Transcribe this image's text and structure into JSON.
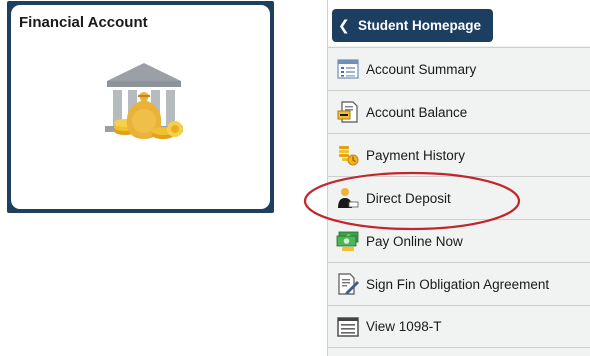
{
  "tile": {
    "title": "Financial Account",
    "icon": "bank-money-icon"
  },
  "nav": {
    "back_button": {
      "label": "Student Homepage",
      "icon": "chevron-left-icon"
    },
    "items": [
      {
        "label": "Account Summary",
        "icon": "list-document-icon"
      },
      {
        "label": "Account Balance",
        "icon": "balance-document-icon"
      },
      {
        "label": "Payment History",
        "icon": "coins-stack-icon"
      },
      {
        "label": "Direct Deposit",
        "icon": "person-deposit-icon"
      },
      {
        "label": "Pay Online Now",
        "icon": "cash-bills-icon"
      },
      {
        "label": "Sign Fin Obligation Agreement",
        "icon": "sign-document-icon"
      },
      {
        "label": "View 1098-T",
        "icon": "form-list-icon"
      }
    ]
  },
  "colors": {
    "tile_frame": "#1f3f5f",
    "back_button": "#1c3e61",
    "highlight_circle": "#c0272d",
    "nav_background": "#f1f2f2"
  }
}
